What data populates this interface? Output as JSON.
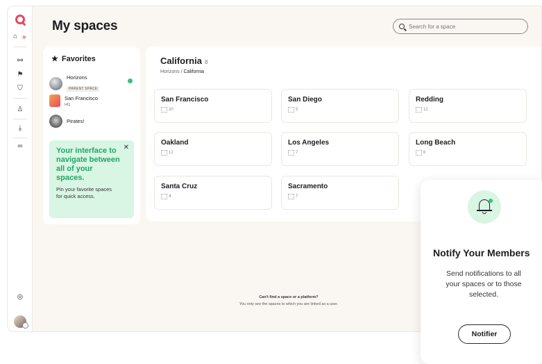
{
  "app": {
    "title": "My spaces",
    "accent": "#e8475f",
    "success": "#39c27b"
  },
  "search": {
    "placeholder": "Search for a space"
  },
  "favorites": {
    "title": "Favorites",
    "items": [
      {
        "name": "Horizons",
        "badge": "PARENT SPACE",
        "checked": true
      },
      {
        "name": "San Francisco",
        "sub": "HQ"
      },
      {
        "name": "Pirates!"
      }
    ],
    "promo": {
      "headline": "Your interface to navigate between all of your spaces.",
      "body": "Pin your favorite spaces for quick access."
    }
  },
  "region": {
    "title": "California",
    "count": "8",
    "breadcrumb_parent": "Horizons",
    "breadcrumb_current": "California",
    "cards": [
      {
        "name": "San Francisco",
        "count": "20"
      },
      {
        "name": "San Diego",
        "count": "5"
      },
      {
        "name": "Redding",
        "count": "12"
      },
      {
        "name": "Oakland",
        "count": "12"
      },
      {
        "name": "Los Angeles",
        "count": "7"
      },
      {
        "name": "Long Beach",
        "count": "6"
      },
      {
        "name": "Santa Cruz",
        "count": "4"
      },
      {
        "name": "Sacramento",
        "count": "7"
      }
    ]
  },
  "footer": {
    "question": "Can't find a space or a platform?",
    "note": "You only see the spaces to which you are linked as a user."
  },
  "notify": {
    "title": "Notify Your Members",
    "body": "Send notifications to all your spaces or to those selected.",
    "button": "Notifier"
  }
}
